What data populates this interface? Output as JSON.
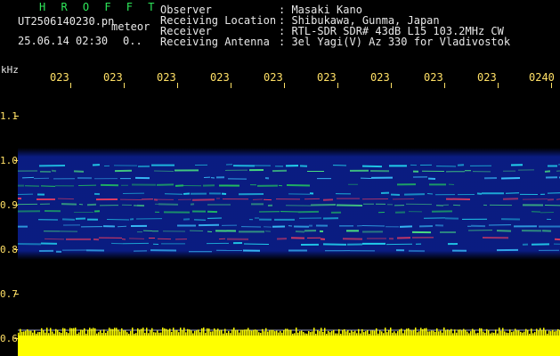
{
  "header": {
    "brand": "H R O F F T",
    "filename": "UT2506140230.pn",
    "mode_label": "meteor",
    "timestamp": "25.06.14 02:30",
    "counter": "0.."
  },
  "metadata": [
    {
      "label": "Observer",
      "value": ": Masaki Kano"
    },
    {
      "label": "Receiving Location",
      "value": ": Shibukawa, Gunma, Japan"
    },
    {
      "label": "Receiver",
      "value": ": RTL-SDR SDR# 43dB L15 103.2MHz CW"
    },
    {
      "label": "Receiving Antenna",
      "value": ": 3el Yagi(V) Az 330 for Vladivostok"
    }
  ],
  "axis": {
    "y_unit": "kHz",
    "y_ticks": [
      "1.1",
      "1.0",
      "0.9",
      "0.8",
      "0.7",
      "0.6"
    ],
    "x_ticks": [
      "023",
      "023",
      "023",
      "023",
      "023",
      "023",
      "023",
      "023",
      "023",
      "0240"
    ]
  },
  "colors": {
    "background": "#000000",
    "text": "#e8e8e8",
    "axis": "#ffe066",
    "brand": "#2ee85a",
    "signal_bar": "#ffff00"
  }
}
